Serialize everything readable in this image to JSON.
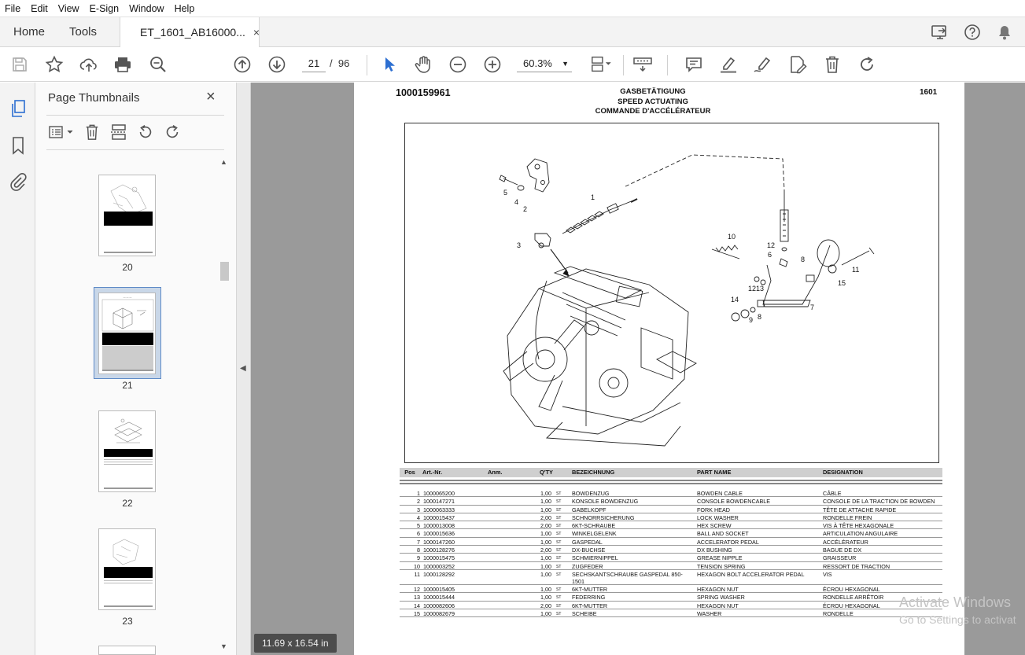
{
  "menu": [
    "File",
    "Edit",
    "View",
    "E-Sign",
    "Window",
    "Help"
  ],
  "tabs": {
    "home": "Home",
    "tools": "Tools",
    "document": "ET_1601_AB16000...",
    "close": "×"
  },
  "toolbar": {
    "current_page": "21",
    "page_separator": "/",
    "total_pages": "96",
    "zoom": "60.3%"
  },
  "thumbnails_panel": {
    "title": "Page Thumbnails",
    "close": "×",
    "pages": [
      {
        "label": "20"
      },
      {
        "label": "21"
      },
      {
        "label": "22"
      },
      {
        "label": "23"
      }
    ],
    "selected": "21"
  },
  "page_size": "11.69 x 16.54 in",
  "document": {
    "number": "1000159961",
    "title_de": "GASBETÄTIGUNG",
    "title_en": "SPEED ACTUATING",
    "title_fr": "COMMANDE D'ACCÉLÉRATEUR",
    "code": "1601",
    "callouts": [
      "1",
      "2",
      "3",
      "4",
      "5",
      "6",
      "7",
      "8",
      "8",
      "9",
      "10",
      "11",
      "12",
      "12",
      "13",
      "14",
      "15"
    ],
    "table_headers": {
      "pos": "Pos",
      "art": "Art.-Nr.",
      "anm": "Anm.",
      "qty": "Q'TY",
      "bez": "BEZEICHNUNG",
      "name": "PART NAME",
      "des": "DESIGNATION"
    },
    "rows": [
      {
        "pos": "1",
        "art": "1000065200",
        "qty": "1,00",
        "unit": "ST",
        "bez": "BOWDENZUG",
        "name": "BOWDEN CABLE",
        "des": "CÂBLE"
      },
      {
        "pos": "2",
        "art": "1000147271",
        "qty": "1,00",
        "unit": "ST",
        "bez": "KONSOLE BOWDENZUG",
        "name": "CONSOLE BOWDENCABLE",
        "des": "CONSOLE DE LA TRACTION DE BOWDEN"
      },
      {
        "pos": "3",
        "art": "1000063333",
        "qty": "1,00",
        "unit": "ST",
        "bez": "GABELKOPF",
        "name": "FORK HEAD",
        "des": "TÊTE DE ATTACHE RAPIDE"
      },
      {
        "pos": "4",
        "art": "1000015437",
        "qty": "2,00",
        "unit": "ST",
        "bez": "SCHNORRSICHERUNG",
        "name": "LOCK WASHER",
        "des": "RONDELLE FREIN"
      },
      {
        "pos": "5",
        "art": "1000013008",
        "qty": "2,00",
        "unit": "ST",
        "bez": "6KT-SCHRAUBE",
        "name": "HEX SCREW",
        "des": "VIS À TÊTE HEXAGONALE"
      },
      {
        "pos": "6",
        "art": "1000015636",
        "qty": "1,00",
        "unit": "ST",
        "bez": "WINKELGELENK",
        "name": "BALL AND SOCKET",
        "des": "ARTICULATION ANGULAIRE"
      },
      {
        "pos": "7",
        "art": "1000147260",
        "qty": "1,00",
        "unit": "ST",
        "bez": "GASPEDAL",
        "name": "ACCELERATOR PEDAL",
        "des": "ACCÉLÉRATEUR"
      },
      {
        "pos": "8",
        "art": "1000128276",
        "qty": "2,00",
        "unit": "ST",
        "bez": "DX-BUCHSE",
        "name": "DX BUSHING",
        "des": "BAGUE DE DX"
      },
      {
        "pos": "9",
        "art": "1000015475",
        "qty": "1,00",
        "unit": "ST",
        "bez": "SCHMIERNIPPEL",
        "name": "GREASE NIPPLE",
        "des": "GRAISSEUR"
      },
      {
        "pos": "10",
        "art": "1000003252",
        "qty": "1,00",
        "unit": "ST",
        "bez": "ZUGFEDER",
        "name": "TENSION SPRING",
        "des": "RESSORT DE TRACTION"
      },
      {
        "pos": "11",
        "art": "1000128292",
        "qty": "1,00",
        "unit": "ST",
        "bez": "SECHSKANTSCHRAUBE GASPEDAL 850-1501",
        "name": "HEXAGON BOLT ACCELERATOR PEDAL",
        "des": "VIS",
        "tall": true
      },
      {
        "pos": "12",
        "art": "1000015405",
        "qty": "1,00",
        "unit": "ST",
        "bez": "6KT-MUTTER",
        "name": "HEXAGON NUT",
        "des": "ÉCROU HEXAGONAL"
      },
      {
        "pos": "13",
        "art": "1000015444",
        "qty": "1,00",
        "unit": "ST",
        "bez": "FEDERRING",
        "name": "SPRING WASHER",
        "des": "RONDELLE ARRÊTOIR"
      },
      {
        "pos": "14",
        "art": "1000082606",
        "qty": "2,00",
        "unit": "ST",
        "bez": "6KT-MUTTER",
        "name": "HEXAGON NUT",
        "des": "ÉCROU HEXAGONAL"
      },
      {
        "pos": "15",
        "art": "1000082679",
        "qty": "1,00",
        "unit": "ST",
        "bez": "SCHEIBE",
        "name": "WASHER",
        "des": "RONDELLE"
      }
    ]
  },
  "watermark": {
    "line1": "Activate Windows",
    "line2": "Go to Settings to activat"
  }
}
